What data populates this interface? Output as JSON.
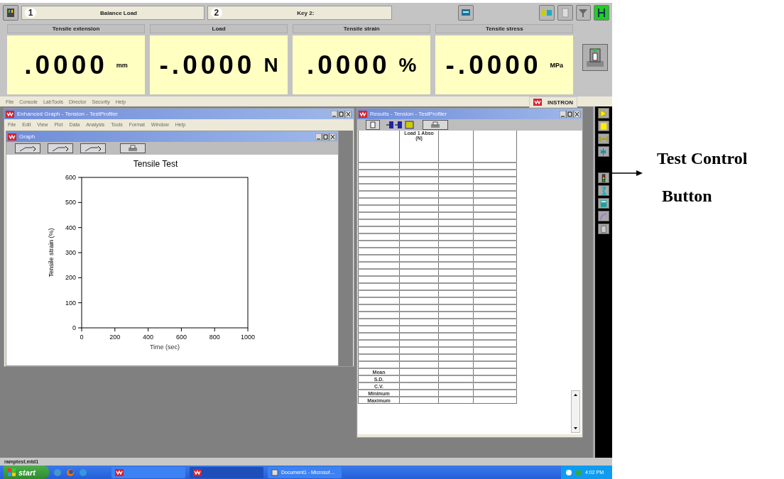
{
  "toolbar": {
    "keys": [
      {
        "number": "1",
        "label": "Balance Load"
      },
      {
        "number": "2",
        "label": "Key 2:"
      }
    ]
  },
  "meters": [
    {
      "label": "Tensile extension",
      "value": ".0000",
      "unit": "mm",
      "kind": "small"
    },
    {
      "label": "Load",
      "value": "-.0000",
      "unit": "N",
      "kind": "large"
    },
    {
      "label": "Tensile strain",
      "value": ".0000",
      "unit": "%",
      "kind": "large"
    },
    {
      "label": "Tensile stress",
      "value": "-.0000",
      "unit": "MPa",
      "kind": "small"
    }
  ],
  "menu_bar": [
    "File",
    "Console",
    "LabTools",
    "Director",
    "Security",
    "Help"
  ],
  "brand": "INSTRON",
  "graph_window": {
    "title": "Enhanced Graph - Tension - TestProfiler",
    "menu": [
      "File",
      "Edit",
      "View",
      "Plot",
      "Data",
      "Analysis",
      "Tools",
      "Format",
      "Window",
      "Help"
    ],
    "graph": {
      "title": "Graph",
      "chart_data": {
        "type": "line",
        "title": "Tensile Test",
        "xlabel": "Time (sec)",
        "ylabel": "Tensile strain (%)",
        "xlim": [
          0,
          1000
        ],
        "ylim": [
          0,
          600
        ],
        "xticks": [
          0,
          200,
          400,
          600,
          800,
          1000
        ],
        "yticks": [
          0,
          100,
          200,
          300,
          400,
          500,
          600
        ]
      }
    }
  },
  "results_window": {
    "title": "Results - Tension - TestProfiler",
    "columns": [
      {
        "title": "Load 1 Abso",
        "unit": "(N)"
      }
    ],
    "statistics": [
      "Mean",
      "S.D.",
      "C.V.",
      "Minimum",
      "Maximum"
    ]
  },
  "status_bar": {
    "text": "ramptest.mtd1"
  },
  "taskbar": {
    "start": "start",
    "tasks": [
      {
        "kind": "app",
        "selected": false
      },
      {
        "kind": "app",
        "selected": true
      },
      {
        "kind": "document",
        "label": "Document1 - Microsof…",
        "selected": false
      }
    ],
    "clock": "4:02 PM"
  },
  "annotation": {
    "lines": [
      "Test Control",
      "Button"
    ]
  }
}
